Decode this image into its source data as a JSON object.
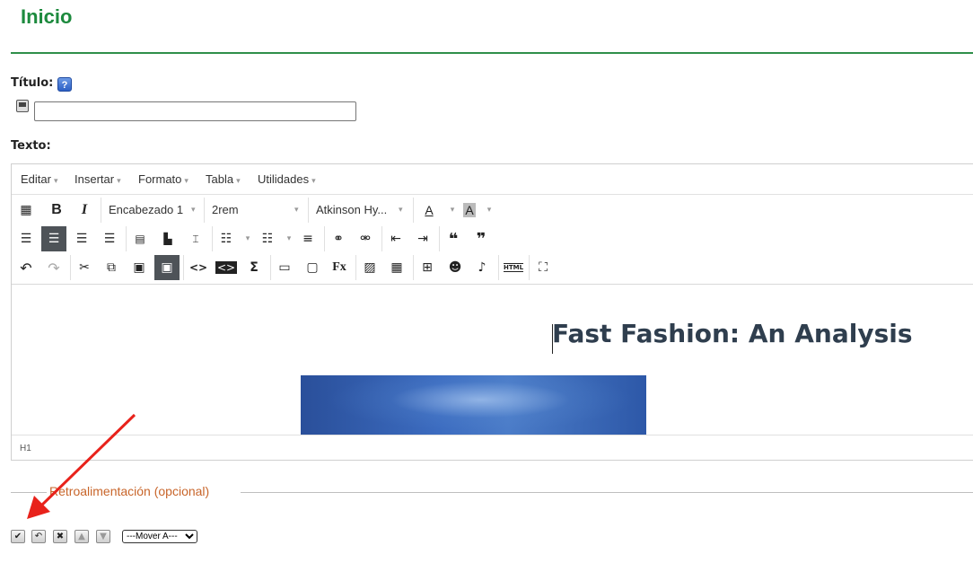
{
  "page": {
    "title": "Inicio"
  },
  "form": {
    "titulo_label": "Título:",
    "help_icon": "help-icon",
    "texto_label": "Texto:"
  },
  "editor": {
    "menus": [
      "Editar",
      "Insertar",
      "Formato",
      "Tabla",
      "Utilidades"
    ],
    "format_block": "Encabezado 1",
    "font_size": "2rem",
    "font_family": "Atkinson Hy...",
    "heading_text": "Fast Fashion: An Analysis",
    "status_path": "H1",
    "icons": {
      "row1": [
        "keyboard-icon",
        "bold-icon",
        "italic-icon",
        "text-color-icon",
        "background-color-icon"
      ],
      "row2": [
        "align-left-icon",
        "align-center-icon",
        "align-right-icon",
        "align-justify-icon",
        "template-icon",
        "wrap-text-icon",
        "format-painter-icon",
        "bullet-list-icon",
        "numbered-list-icon",
        "outline-icon",
        "link-icon",
        "unlink-icon",
        "outdent-icon",
        "indent-icon",
        "blockquote-icon",
        "unquote-icon"
      ],
      "row3": [
        "undo-icon",
        "redo-icon",
        "cut-icon",
        "copy-icon",
        "paste-icon",
        "paste-text-icon",
        "code-icon",
        "source-code-icon",
        "sigma-icon",
        "comment-icon",
        "fullpage-icon",
        "formula-icon",
        "image-icon",
        "media-icon",
        "diagram-icon",
        "speech-icon",
        "music-icon",
        "html-icon",
        "fullscreen-icon"
      ]
    },
    "active_states": {
      "align_center": true,
      "paste_text": true
    }
  },
  "feedback": {
    "legend": "Retroalimentación (opcional)"
  },
  "actions": {
    "move_select_value": "---Mover A---",
    "icons": [
      "save-check-icon",
      "undo-icon",
      "delete-icon",
      "move-up-icon",
      "move-down-icon"
    ]
  },
  "colors": {
    "title_green": "#1d8a3e",
    "legend_orange": "#c8652a",
    "annotation_red": "#e8221b",
    "heading": "#2f3e4e"
  }
}
